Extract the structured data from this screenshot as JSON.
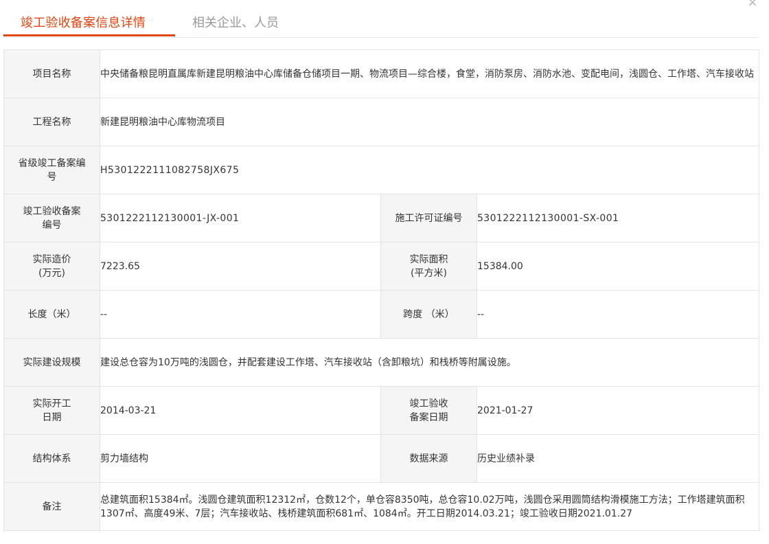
{
  "tabs": {
    "active": "竣工验收备案信息详情",
    "inactive": "相关企业、人员"
  },
  "close_glyph": "×",
  "rows": {
    "project_name": {
      "label": "项目名称",
      "value": "中央储备粮昆明直属库新建昆明粮油中心库储备仓储项目一期、物流项目—综合楼，食堂，消防泵房、消防水池、变配电间，浅圆仓、工作塔、汽车接收站"
    },
    "engineering_name": {
      "label": "工程名称",
      "value": "新建昆明粮油中心库物流项目"
    },
    "provincial_record_no": {
      "label_line1": "省级竣工备案编",
      "label_line2": "号",
      "value": "H5301222111082758JX675"
    },
    "record_no": {
      "label_line1": "竣工验收备案",
      "label_line2": "编号",
      "value": "5301222112130001-JX-001"
    },
    "permit_no": {
      "label": "施工许可证编号",
      "value": "5301222112130001-SX-001"
    },
    "actual_cost": {
      "label_line1": "实际造价",
      "label_line2": "(万元)",
      "value": "7223.65"
    },
    "actual_area": {
      "label_line1": "实际面积",
      "label_line2": "(平方米)",
      "value": "15384.00"
    },
    "length": {
      "label": "长度（米）",
      "value": "--"
    },
    "span": {
      "label": "跨度 （米）",
      "value": "--"
    },
    "scale": {
      "label": "实际建设规模",
      "value": "建设总仓容为10万吨的浅圆仓，并配套建设工作塔、汽车接收站（含卸粮坑）和栈桥等附属设施。"
    },
    "start_date": {
      "label_line1": "实际开工",
      "label_line2": "日期",
      "value": "2014-03-21"
    },
    "record_date": {
      "label_line1": "竣工验收",
      "label_line2": "备案日期",
      "value": "2021-01-27"
    },
    "structure": {
      "label": "结构体系",
      "value": "剪力墙结构"
    },
    "data_source": {
      "label": "数据来源",
      "value": "历史业绩补录"
    },
    "remarks": {
      "label": "备注",
      "value": "总建筑面积15384㎡。浅圆仓建筑面积12312㎡，仓数12个，单仓容8350吨，总仓容10.02万吨，浅圆仓采用圆筒结构滑模施工方法；工作塔建筑面积1307㎡、高度49米、7层；汽车接收站、栈桥建筑面积681㎡、1084㎡。开工日期2014.03.21；竣工验收日期2021.01.27"
    }
  }
}
